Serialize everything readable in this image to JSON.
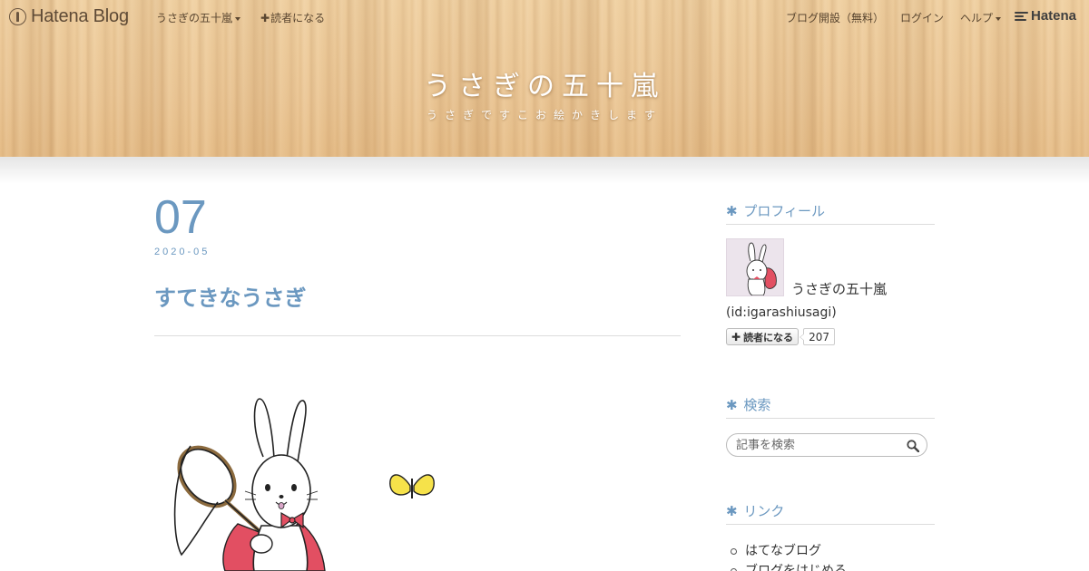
{
  "globalnav": {
    "logo_text": "Hatena Blog",
    "blog_menu_label": "うさぎの五十嵐",
    "subscribe_label": "読者になる",
    "open_blog_label": "ブログ開設（無料）",
    "login_label": "ログイン",
    "help_label": "ヘルプ",
    "hatena_label": "Hatena"
  },
  "blog": {
    "title": "うさぎの五十嵐",
    "description": "うさぎですこお絵かきします"
  },
  "entry": {
    "date_day": "07",
    "date_year_month": "2020-05",
    "title": "すてきなうさぎ"
  },
  "sidebar": {
    "profile": {
      "heading": "プロフィール",
      "name": "うさぎの五十嵐",
      "id": "(id:igarashiusagi)",
      "subscribe_label": "読者になる",
      "reader_count": "207"
    },
    "search": {
      "heading": "検索",
      "placeholder": "記事を検索"
    },
    "links": {
      "heading": "リンク",
      "items": [
        "はてなブログ",
        "ブログをはじめる"
      ]
    }
  },
  "colors": {
    "accent": "#6b98c0",
    "wood": "#eac594"
  },
  "icons": {
    "logo": "hatena-blog-pen-icon",
    "heading": "asterisk-icon",
    "search": "search-icon"
  }
}
